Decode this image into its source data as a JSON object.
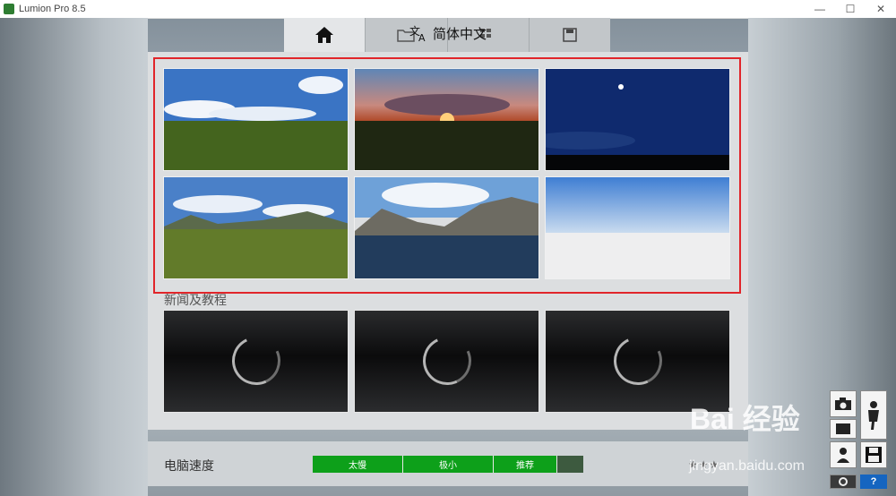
{
  "window": {
    "title": "Lumion Pro 8.5",
    "controls": [
      "—",
      "☐",
      "✕"
    ]
  },
  "toolbar": {
    "tabs": [
      {
        "name": "home",
        "icon": "home-icon"
      },
      {
        "name": "open",
        "icon": "folder-icon"
      },
      {
        "name": "save",
        "icon": "save-icon"
      }
    ],
    "language": {
      "label": "简体中文",
      "icon": "translate-icon"
    }
  },
  "scenes": [
    {
      "name": "blue-sky-grass",
      "icon": "scene-thumbnail"
    },
    {
      "name": "sunset-grass",
      "icon": "scene-thumbnail"
    },
    {
      "name": "night-sky",
      "icon": "scene-thumbnail"
    },
    {
      "name": "mountain-grass",
      "icon": "scene-thumbnail"
    },
    {
      "name": "mountain-water",
      "icon": "scene-thumbnail"
    },
    {
      "name": "plain-white",
      "icon": "scene-thumbnail"
    }
  ],
  "news": {
    "label": "新闻及教程",
    "tiles": 3
  },
  "footer": {
    "speed_label": "电脑速度",
    "speed_segments": [
      "太慢",
      "极小",
      "推荐"
    ],
    "speed_fill": 0.9,
    "stars": "★★★"
  },
  "watermark": {
    "text": "Bai 经验",
    "url": "jingyan.baidu.com"
  },
  "colors": {
    "accent_green": "#0da01a",
    "highlight_red": "#e1252a"
  }
}
